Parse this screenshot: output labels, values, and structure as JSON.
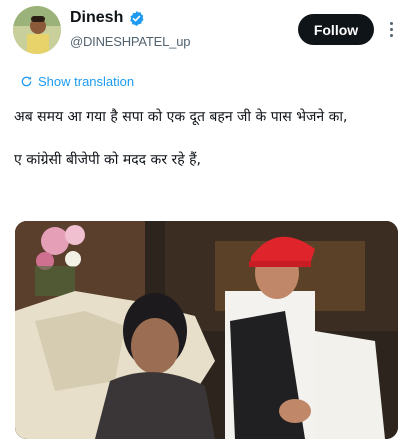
{
  "author": {
    "name": "Dinesh",
    "handle": "@DINESHPATEL_up",
    "verified": true
  },
  "actions": {
    "follow_label": "Follow",
    "more_icon": "more-vertical-icon"
  },
  "translation": {
    "label": "Show translation",
    "icon": "globe-icon"
  },
  "tweet": {
    "line1": "अब समय आ गया है सपा को एक दूत बहन जी के पास भेजने का,",
    "line2": "ए कांग्रेसी बीजेपी को मदद कर रहे हैं,"
  },
  "colors": {
    "accent": "#1d9bf0",
    "text": "#0f1419",
    "secondary": "#536471",
    "follow_bg": "#0f1419",
    "red_cap": "#e0242c"
  }
}
